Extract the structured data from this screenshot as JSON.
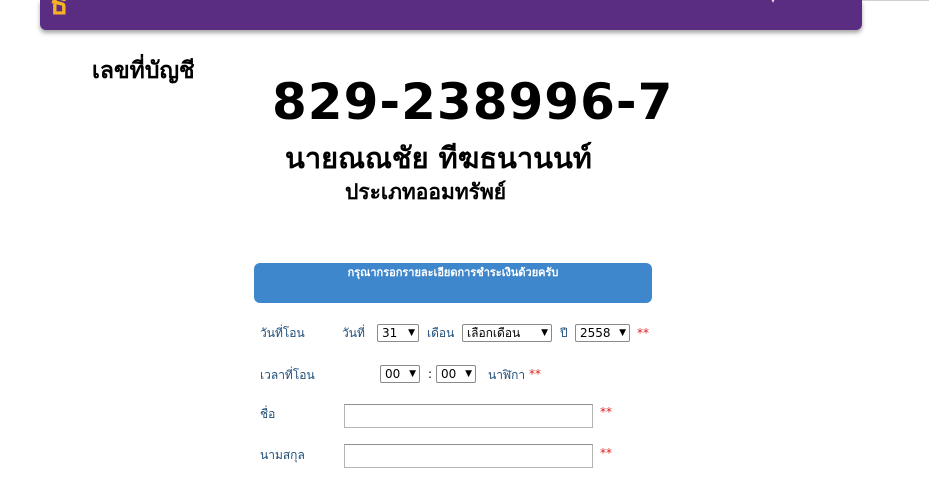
{
  "header": {
    "logo_text": "ธ"
  },
  "account": {
    "label": "เลขที่บัญชี",
    "number": "829-238996-7",
    "holder_name": "นายณณชัย ทีฆธนานนท์",
    "type": "ประเภทออมทรัพย์"
  },
  "form": {
    "banner_text": "กรุณากรอกรายละเอียดการชำระเงินด้วยครับ",
    "transfer_date": {
      "label": "วันที่โอน",
      "day_label": "วันที่",
      "day_value": "31",
      "month_label": "เดือน",
      "month_value": "เลือกเดือน",
      "year_label": "ปี",
      "year_value": "2558",
      "required_mark": "**"
    },
    "transfer_time": {
      "label": "เวลาที่โอน",
      "hour_value": "00",
      "separator": ":",
      "minute_value": "00",
      "unit_label": "นาฬิกา",
      "required_mark": "**"
    },
    "first_name": {
      "label": "ชื่อ",
      "value": "",
      "required_mark": "**"
    },
    "last_name": {
      "label": "นามสกุล",
      "value": "",
      "required_mark": "**"
    }
  }
}
